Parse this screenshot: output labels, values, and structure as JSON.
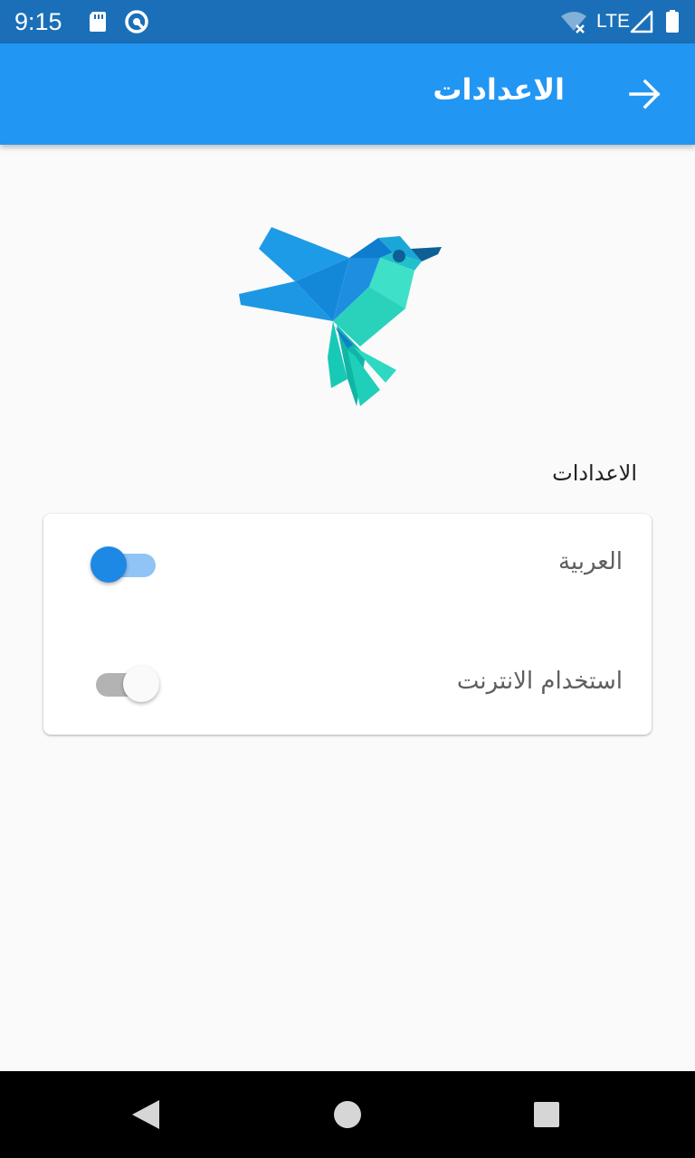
{
  "status_bar": {
    "time": "9:15",
    "network": "LTE",
    "icons": [
      "sd-card-icon",
      "do-not-disturb-icon",
      "wifi-off-icon",
      "signal-icon",
      "battery-icon"
    ]
  },
  "app_bar": {
    "title": "الاعدادات",
    "back_icon": "arrow-right-icon",
    "color": "#2196f3"
  },
  "logo": {
    "icon": "hummingbird-logo-icon"
  },
  "settings": {
    "heading": "الاعدادات",
    "items": [
      {
        "label": "العربية",
        "enabled": true
      },
      {
        "label": "استخدام الانترنت",
        "enabled": false
      }
    ]
  },
  "nav_bar": {
    "icons": [
      "back-triangle-icon",
      "home-circle-icon",
      "recents-square-icon"
    ]
  },
  "colors": {
    "status_bar": "#1a6fb8",
    "accent": "#1e88e5",
    "background": "#fafafa"
  }
}
